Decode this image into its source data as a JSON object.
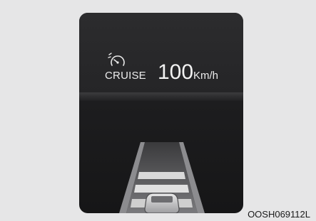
{
  "display": {
    "cruise_label": "CRUISE",
    "speed_value": "100",
    "speed_unit": "Km/h",
    "icon": "cruise-control-icon"
  },
  "caption": "OOSH069112L",
  "colors": {
    "background": "#e6e6e7",
    "panel": "#1e1e20",
    "text": "#ececec",
    "road": "#6f6f72",
    "bar": "#d8d8d8"
  }
}
